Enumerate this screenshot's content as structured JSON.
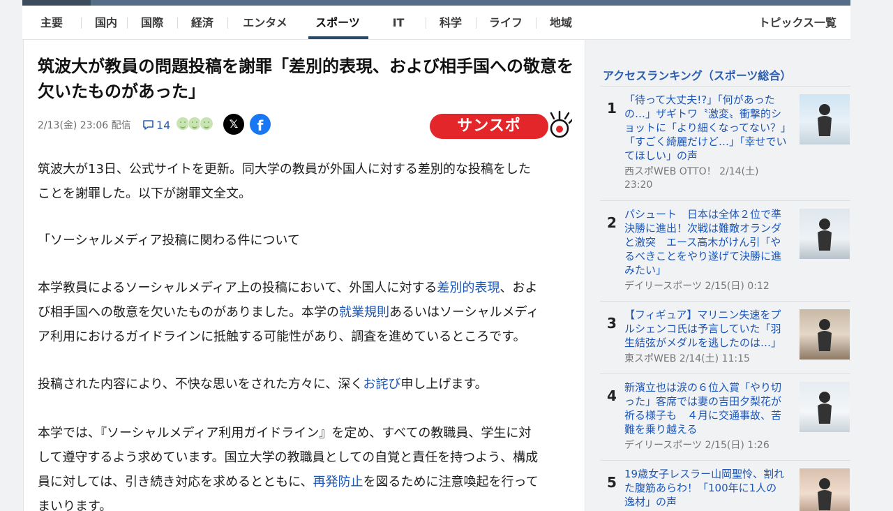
{
  "nav": {
    "items": [
      "主要",
      "国内",
      "国際",
      "経済",
      "エンタメ",
      "スポーツ",
      "IT",
      "科学",
      "ライフ",
      "地域"
    ],
    "active": "スポーツ",
    "topics_label": "トピックス一覧"
  },
  "article": {
    "title": "筑波大が教員の問題投稿を謝罪「差別的表現、および相手国への敬意を欠いたものがあった」",
    "date": "2/13(金) 23:06",
    "delivered": "配信",
    "comment_count": "14",
    "publisher_logo_text": "サンスポ",
    "paragraphs": [
      {
        "lines": [
          [
            {
              "t": "筑波大が13日、公式サイトを更新。同大学の教員が外国人に対する差別的な投稿をした"
            }
          ],
          [
            {
              "t": "ことを謝罪した。以下が謝罪文全文。"
            }
          ]
        ]
      },
      {
        "lines": [
          [
            {
              "t": "「ソーシャルメディア投稿に関わる件について"
            }
          ]
        ]
      },
      {
        "lines": [
          [
            {
              "t": "本学教員によるソーシャルメディア上の投稿において、外国人に対する"
            },
            {
              "t": "差別的表現",
              "link": true
            },
            {
              "t": "、およ"
            }
          ],
          [
            {
              "t": "び相手国への敬意を欠いたものがありました。本学の"
            },
            {
              "t": "就業規則",
              "link": true
            },
            {
              "t": "あるいはソーシャルメディ"
            }
          ],
          [
            {
              "t": "ア利用におけるガイドラインに抵触する可能性があり、調査を進めているところです。"
            }
          ]
        ]
      },
      {
        "lines": [
          [
            {
              "t": "投稿された内容により、不快な思いをされた方々に、深く"
            },
            {
              "t": "お詫び",
              "link": true
            },
            {
              "t": "申し上げます。"
            }
          ]
        ]
      },
      {
        "lines": [
          [
            {
              "t": "本学では、『ソーシャルメディア利用ガイドライン』を定め、すべての教職員、学生に対"
            }
          ],
          [
            {
              "t": "して遵守するよう求めています。国立大学の教職員としての自覚と責任を持つよう、構成"
            }
          ],
          [
            {
              "t": "員に対しては、引き続き対応を求めるとともに、"
            },
            {
              "t": "再発防止",
              "link": true
            },
            {
              "t": "を図るために注意喚起を行って"
            }
          ],
          [
            {
              "t": "まいります。"
            }
          ]
        ]
      }
    ]
  },
  "ranking": {
    "title": "アクセスランキング（スポーツ総合）",
    "items": [
      {
        "rank": "1",
        "lines": [
          "「待って大丈夫!?」「何があった",
          "の…」ザギトワ〝激変〟衝撃的シ",
          "ョットに「より細くなってない？」",
          "「すごく綺麗だけど…」「幸せでい",
          "てほしい」の声"
        ],
        "source_lines": [
          "西スポWEB OTTO！ 2/14(土)",
          "23:20"
        ]
      },
      {
        "rank": "2",
        "lines": [
          "パシュート　日本は全体２位で準",
          "決勝に進出！次戦は難敵オランダ",
          "と激突　エース高木がけん引「や",
          "るべきことをやり遂げて決勝に進",
          "みたい」"
        ],
        "source_lines": [
          "デイリースポーツ 2/15(日) 0:12"
        ]
      },
      {
        "rank": "3",
        "lines": [
          "【フィギュア】マリニン失速をプ",
          "ルシェンコ氏は予言していた「羽",
          "生結弦がメダルを逃したのは…」"
        ],
        "source_lines": [
          "東スポWEB 2/14(土) 11:15"
        ]
      },
      {
        "rank": "4",
        "lines": [
          "新濱立也は涙の６位入賞「やり切",
          "った」客席では妻の吉田夕梨花が",
          "祈る様子も　４月に交通事故、苦",
          "難を乗り越える"
        ],
        "source_lines": [
          "デイリースポーツ 2/15(日) 1:26"
        ]
      },
      {
        "rank": "5",
        "lines": [
          "19歳女子レスラー山岡聖怜、割れ",
          "た腹筋あらわ！「100年に1人の",
          "逸材」の声"
        ],
        "source_lines": []
      }
    ]
  },
  "colors": {
    "link": "#1c56b8",
    "nav_active_underline": "#2f4a67",
    "brand_red": "#e3262a",
    "facebook": "#1877f2"
  }
}
